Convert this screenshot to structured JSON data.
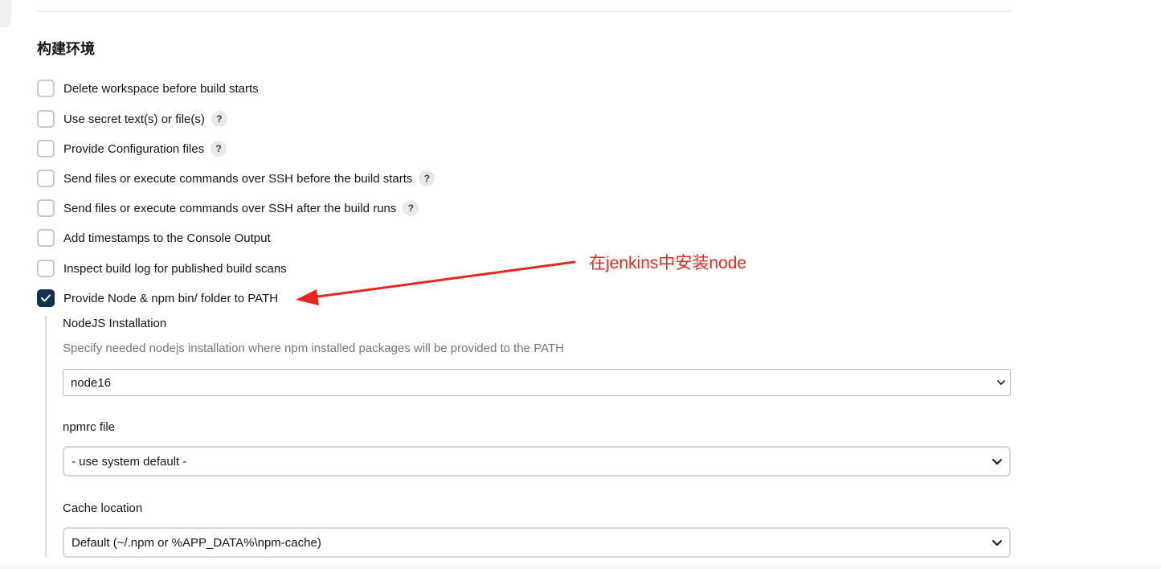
{
  "section": {
    "title": "构建环境"
  },
  "options": [
    {
      "label": "Delete workspace before build starts",
      "checked": false,
      "help": false
    },
    {
      "label": "Use secret text(s) or file(s)",
      "checked": false,
      "help": true
    },
    {
      "label": "Provide Configuration files",
      "checked": false,
      "help": true
    },
    {
      "label": "Send files or execute commands over SSH before the build starts",
      "checked": false,
      "help": true
    },
    {
      "label": "Send files or execute commands over SSH after the build runs",
      "checked": false,
      "help": true
    },
    {
      "label": "Add timestamps to the Console Output",
      "checked": false,
      "help": false
    },
    {
      "label": "Inspect build log for published build scans",
      "checked": false,
      "help": false
    },
    {
      "label": "Provide Node & npm bin/ folder to PATH",
      "checked": true,
      "help": false
    }
  ],
  "help_glyph": "?",
  "nodejs": {
    "label": "NodeJS Installation",
    "description": "Specify needed nodejs installation where npm installed packages will be provided to the PATH",
    "selected": "node16"
  },
  "npmrc": {
    "label": "npmrc file",
    "selected": "- use system default -"
  },
  "cache": {
    "label": "Cache location",
    "selected": "Default (~/.npm or %APP_DATA%\\npm-cache)"
  },
  "annotation": {
    "text": "在jenkins中安装node",
    "color": "#e8281e"
  },
  "colors": {
    "checkbox_checked": "#13314f",
    "checkbox_border": "#c8c9d0",
    "description_text": "#75757f"
  },
  "icons": {
    "check": "check-icon",
    "help": "help-icon",
    "chevron": "chevron-down-icon",
    "arrow": "annotation-arrow"
  }
}
